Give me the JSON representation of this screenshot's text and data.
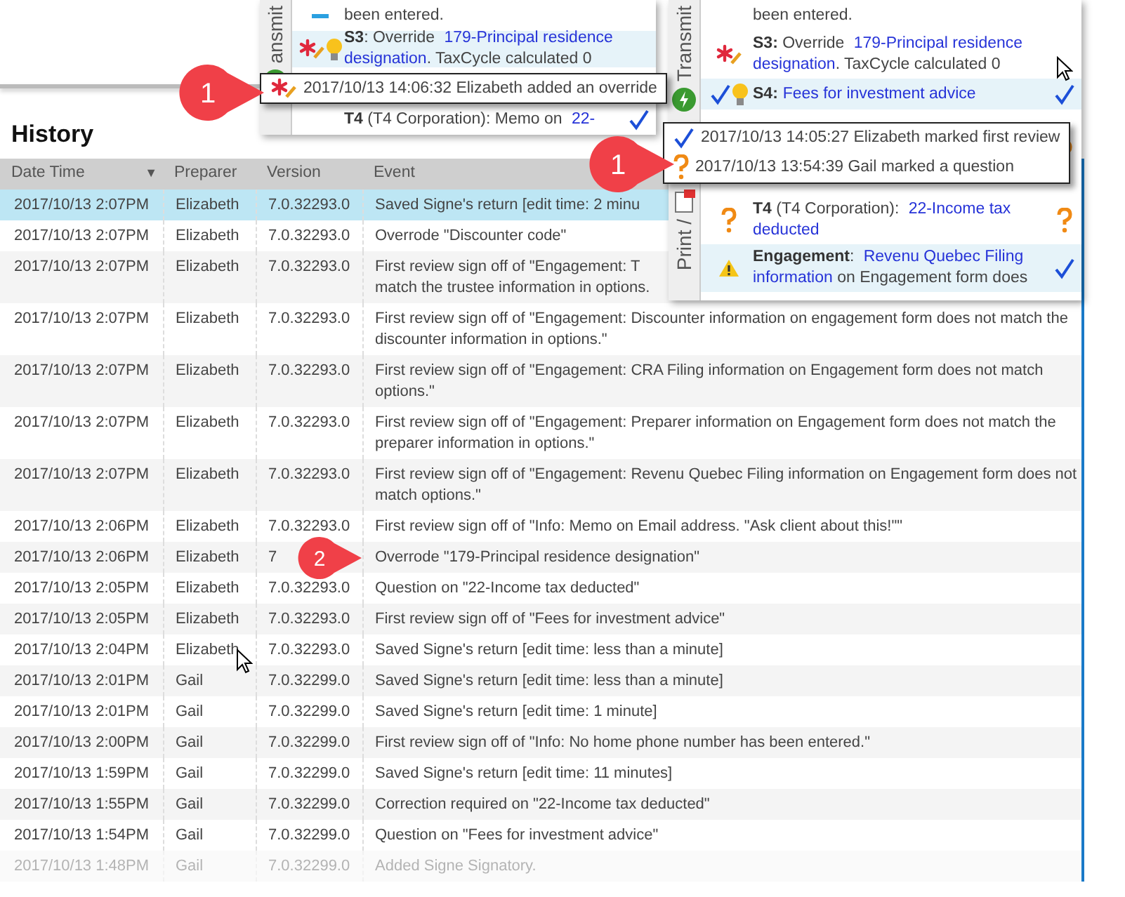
{
  "heading": "History",
  "columns": [
    {
      "label": "Date Time",
      "sort": "▼"
    },
    {
      "label": "Preparer"
    },
    {
      "label": "Version"
    },
    {
      "label": "Event"
    }
  ],
  "rows": [
    {
      "date": "2017/10/13 2:07PM",
      "preparer": "Elizabeth",
      "version": "7.0.32293.0",
      "event": "Saved Signe's return [edit time: 2 minu",
      "selected": true,
      "faded": false
    },
    {
      "date": "2017/10/13 2:07PM",
      "preparer": "Elizabeth",
      "version": "7.0.32293.0",
      "event": "Overrode \"Discounter code\"",
      "selected": false,
      "faded": false
    },
    {
      "date": "2017/10/13 2:07PM",
      "preparer": "Elizabeth",
      "version": "7.0.32293.0",
      "event": "First review sign off of \"Engagement: T\nmatch the trustee information in options.",
      "selected": false,
      "faded": false
    },
    {
      "date": "2017/10/13 2:07PM",
      "preparer": "Elizabeth",
      "version": "7.0.32293.0",
      "event": "First review sign off of \"Engagement: Discounter information on engagement form does not match the discounter information in options.\"",
      "selected": false,
      "faded": false
    },
    {
      "date": "2017/10/13 2:07PM",
      "preparer": "Elizabeth",
      "version": "7.0.32293.0",
      "event": "First review sign off of \"Engagement: CRA Filing information on Engagement form does not match options.\"",
      "selected": false,
      "faded": false
    },
    {
      "date": "2017/10/13 2:07PM",
      "preparer": "Elizabeth",
      "version": "7.0.32293.0",
      "event": "First review sign off of \"Engagement: Preparer information on Engagement form does not match the preparer information in options.\"",
      "selected": false,
      "faded": false
    },
    {
      "date": "2017/10/13 2:07PM",
      "preparer": "Elizabeth",
      "version": "7.0.32293.0",
      "event": "First review sign off of \"Engagement: Revenu Quebec Filing information on Engagement form does not match options.\"",
      "selected": false,
      "faded": false
    },
    {
      "date": "2017/10/13 2:06PM",
      "preparer": "Elizabeth",
      "version": "7.0.32293.0",
      "event": "First review sign off of \"Info: Memo on Email address. \"Ask client about this!\"\"",
      "selected": false,
      "faded": false
    },
    {
      "date": "2017/10/13 2:06PM",
      "preparer": "Elizabeth",
      "version": "7",
      "event": "Overrode \"179-Principal residence designation\"",
      "selected": false,
      "faded": false
    },
    {
      "date": "2017/10/13 2:05PM",
      "preparer": "Elizabeth",
      "version": "7.0.32293.0",
      "event": "Question on \"22-Income tax deducted\"",
      "selected": false,
      "faded": false
    },
    {
      "date": "2017/10/13 2:05PM",
      "preparer": "Elizabeth",
      "version": "7.0.32293.0",
      "event": "First review sign off of \"Fees for investment advice\"",
      "selected": false,
      "faded": false
    },
    {
      "date": "2017/10/13 2:04PM",
      "preparer": "Elizabeth",
      "version": "7.0.32293.0",
      "event": "Saved Signe's return [edit time: less than a minute]",
      "selected": false,
      "faded": false
    },
    {
      "date": "2017/10/13 2:01PM",
      "preparer": "Gail",
      "version": "7.0.32299.0",
      "event": "Saved Signe's return [edit time: less than a minute]",
      "selected": false,
      "faded": false
    },
    {
      "date": "2017/10/13 2:01PM",
      "preparer": "Gail",
      "version": "7.0.32299.0",
      "event": "Saved Signe's return [edit time: 1 minute]",
      "selected": false,
      "faded": false
    },
    {
      "date": "2017/10/13 2:00PM",
      "preparer": "Gail",
      "version": "7.0.32299.0",
      "event": "First review sign off of \"Info: No home phone number has been entered.\"",
      "selected": false,
      "faded": false
    },
    {
      "date": "2017/10/13 1:59PM",
      "preparer": "Gail",
      "version": "7.0.32299.0",
      "event": "Saved Signe's return [edit time: 11 minutes]",
      "selected": false,
      "faded": false
    },
    {
      "date": "2017/10/13 1:55PM",
      "preparer": "Gail",
      "version": "7.0.32299.0",
      "event": "Correction required on \"22-Income tax deducted\"",
      "selected": false,
      "faded": false
    },
    {
      "date": "2017/10/13 1:54PM",
      "preparer": "Gail",
      "version": "7.0.32299.0",
      "event": "Question on \"Fees for investment advice\"",
      "selected": false,
      "faded": false
    },
    {
      "date": "2017/10/13 1:48PM",
      "preparer": "Gail",
      "version": "7.0.32299.0",
      "event": "Added Signe Signatory.",
      "selected": false,
      "faded": true
    }
  ],
  "left_panel": {
    "tabs": [
      "ansmit"
    ],
    "items": [
      {
        "kind": "info",
        "parts": [
          {
            "kind": "plain",
            "text": "been entered."
          }
        ],
        "noted": false,
        "reviewed": false,
        "selected": false
      },
      {
        "kind": "override",
        "parts": [
          {
            "kind": "bold",
            "text": "S3"
          },
          {
            "kind": "plain",
            "text": ": Override "
          },
          {
            "kind": "link",
            "text": "179-Principal residence designation"
          },
          {
            "kind": "plain",
            "text": ". TaxCycle calculated 0"
          }
        ],
        "noted": true,
        "reviewed": false,
        "selected": true
      },
      {
        "kind": "plain",
        "parts": [
          {
            "kind": "bold",
            "text": "T4"
          },
          {
            "kind": "plain",
            "text": " (T4 Corporation): Memo on "
          },
          {
            "kind": "link",
            "text": "22-"
          }
        ],
        "noted": false,
        "reviewed": true,
        "selected": false
      }
    ],
    "tooltip": [
      {
        "kind": "override",
        "text": "2017/10/13 14:06:32 Elizabeth added an override"
      }
    ],
    "callout": "1"
  },
  "right_panel": {
    "tabs": [
      "Transmit",
      "Print /"
    ],
    "items": [
      {
        "kind": "plain",
        "parts": [
          {
            "kind": "plain",
            "text": "been entered."
          }
        ],
        "noted": false,
        "reviewed": false,
        "selected": false
      },
      {
        "kind": "override",
        "parts": [
          {
            "kind": "bold",
            "text": "S3:"
          },
          {
            "kind": "plain",
            "text": " Override "
          },
          {
            "kind": "link",
            "text": "179-Principal residence designation"
          },
          {
            "kind": "plain",
            "text": ". TaxCycle calculated 0"
          }
        ],
        "noted": false,
        "reviewed": false,
        "selected": false
      },
      {
        "kind": "reviewed",
        "parts": [
          {
            "kind": "bold",
            "text": "S4:"
          },
          {
            "kind": "link",
            "text": "Fees for investment advice"
          }
        ],
        "noted": true,
        "reviewed": true,
        "selected": true
      },
      {
        "kind": "question",
        "parts": [
          {
            "kind": "bold",
            "text": "T4"
          },
          {
            "kind": "plain",
            "text": " (T4 Corporation): "
          },
          {
            "kind": "link",
            "text": "22-Income tax deducted"
          }
        ],
        "noted": false,
        "reviewed": false,
        "selected": false
      },
      {
        "kind": "warning",
        "parts": [
          {
            "kind": "bold",
            "text": "Engagement"
          },
          {
            "kind": "plain",
            "text": ": "
          },
          {
            "kind": "link",
            "text": "Revenu Quebec Filing information"
          },
          {
            "kind": "plain",
            "text": " on Engagement form does"
          }
        ],
        "noted": false,
        "reviewed": true,
        "selected": true
      }
    ],
    "tooltip": [
      {
        "kind": "reviewed",
        "text": "2017/10/13 14:05:27 Elizabeth marked first review"
      },
      {
        "kind": "question",
        "text": "2017/10/13 13:54:39 Gail marked a question"
      }
    ],
    "callout": "1"
  },
  "row_callout": "2"
}
